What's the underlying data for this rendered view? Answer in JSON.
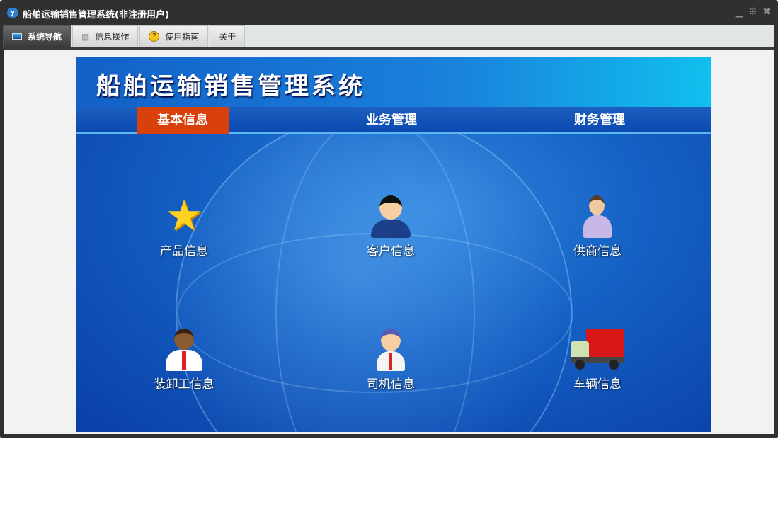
{
  "window": {
    "title": "船舶运输销售管理系统(非注册用户)",
    "controls": [
      "minimize",
      "restore",
      "close"
    ]
  },
  "tabs": [
    {
      "label": "系统导航",
      "icon": "monitor-icon",
      "active": true
    },
    {
      "label": "信息操作",
      "icon": "grid-icon"
    },
    {
      "label": "使用指南",
      "icon": "help-icon"
    },
    {
      "label": "关于"
    }
  ],
  "banner": {
    "title": "船舶运输销售管理系统",
    "nav": [
      {
        "label": "基本信息",
        "active": true
      },
      {
        "label": "业务管理"
      },
      {
        "label": "财务管理"
      }
    ],
    "items": [
      {
        "label": "产品信息",
        "icon": "star-icon"
      },
      {
        "label": "客户信息",
        "icon": "customer-icon"
      },
      {
        "label": "供商信息",
        "icon": "supplier-icon"
      },
      {
        "label": "装卸工信息",
        "icon": "worker-icon"
      },
      {
        "label": "司机信息",
        "icon": "driver-icon"
      },
      {
        "label": "车辆信息",
        "icon": "truck-icon"
      }
    ]
  }
}
